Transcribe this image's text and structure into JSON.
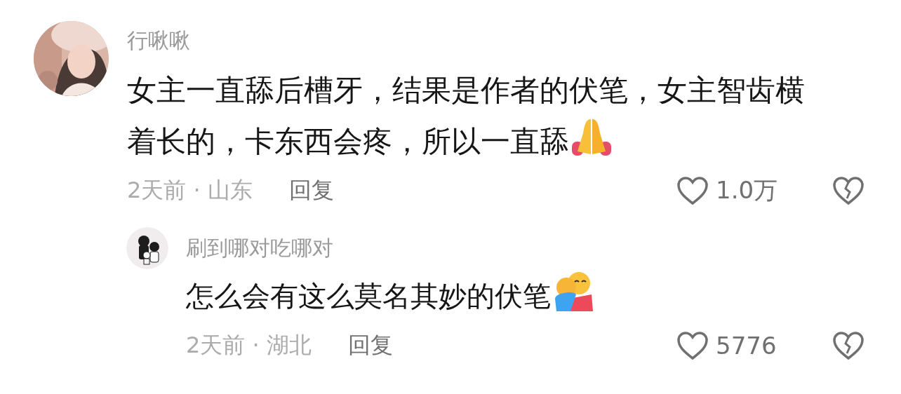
{
  "comments": [
    {
      "author": "行啾啾",
      "text": "女主一直舔后槽牙，结果是作者的伏笔，女主智齿横着长的，卡东西会疼，所以一直舔",
      "meta": "2天前 · 山东",
      "reply_label": "回复",
      "likes": "1.0万",
      "liked": false,
      "replies": [
        {
          "author": "刷到哪对吃哪对",
          "text": "怎么会有这么莫名其妙的伏笔",
          "meta": "2天前 · 湖北",
          "reply_label": "回复",
          "likes": "5776",
          "liked": false
        }
      ]
    }
  ]
}
